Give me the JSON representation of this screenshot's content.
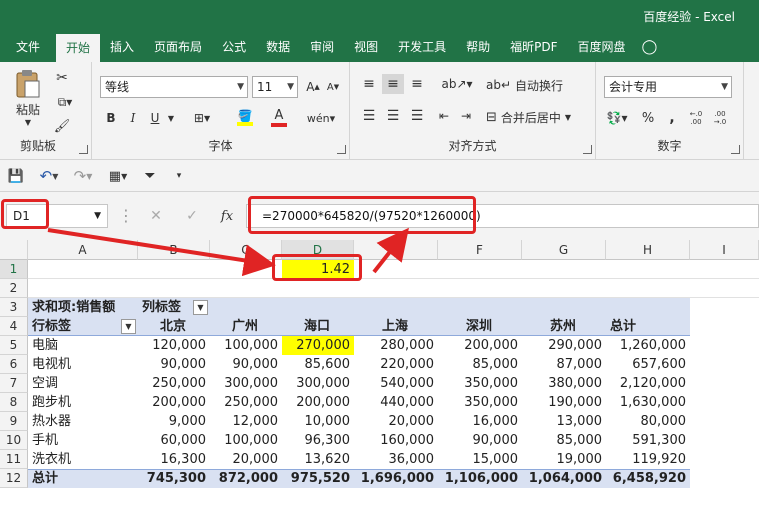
{
  "app": {
    "title": "百度经验 - Excel"
  },
  "tabs": [
    "文件",
    "开始",
    "插入",
    "页面布局",
    "公式",
    "数据",
    "审阅",
    "视图",
    "开发工具",
    "帮助",
    "福昕PDF",
    "百度网盘"
  ],
  "ribbon": {
    "clipboard": {
      "paste": "粘贴",
      "label": "剪贴板"
    },
    "font": {
      "name": "等线",
      "size": "11",
      "label": "字体",
      "bold": "B",
      "italic": "I",
      "underline": "U"
    },
    "align": {
      "wrap": "自动换行",
      "merge": "合并后居中",
      "label": "对齐方式"
    },
    "number": {
      "format": "会计专用",
      "percent": "%",
      "label": "数字"
    }
  },
  "namebox": "D1",
  "formula": "=270000*645820/(97520*1260000)",
  "columns": [
    "A",
    "B",
    "C",
    "D",
    "E",
    "F",
    "G",
    "H",
    "I"
  ],
  "rows": [
    "1",
    "2",
    "3",
    "4",
    "5",
    "6",
    "7",
    "8",
    "9",
    "10",
    "11",
    "12"
  ],
  "d1_value": "1.42",
  "pivot": {
    "header_label": "求和项:销售额",
    "col_label": "列标签",
    "row_label": "行标签",
    "cities": [
      "北京",
      "广州",
      "海口",
      "上海",
      "深圳",
      "苏州",
      "总计"
    ],
    "data": [
      {
        "name": "电脑",
        "values": [
          "120,000",
          "100,000",
          "270,000",
          "280,000",
          "200,000",
          "290,000",
          "1,260,000"
        ]
      },
      {
        "name": "电视机",
        "values": [
          "90,000",
          "90,000",
          "85,600",
          "220,000",
          "85,000",
          "87,000",
          "657,600"
        ]
      },
      {
        "name": "空调",
        "values": [
          "250,000",
          "300,000",
          "300,000",
          "540,000",
          "350,000",
          "380,000",
          "2,120,000"
        ]
      },
      {
        "name": "跑步机",
        "values": [
          "200,000",
          "250,000",
          "200,000",
          "440,000",
          "350,000",
          "190,000",
          "1,630,000"
        ]
      },
      {
        "name": "热水器",
        "values": [
          "9,000",
          "12,000",
          "10,000",
          "20,000",
          "16,000",
          "13,000",
          "80,000"
        ]
      },
      {
        "name": "手机",
        "values": [
          "60,000",
          "100,000",
          "96,300",
          "160,000",
          "90,000",
          "85,000",
          "591,300"
        ]
      },
      {
        "name": "洗衣机",
        "values": [
          "16,300",
          "20,000",
          "13,620",
          "36,000",
          "15,000",
          "19,000",
          "119,920"
        ]
      }
    ],
    "total": {
      "name": "总计",
      "values": [
        "745,300",
        "872,000",
        "975,520",
        "1,696,000",
        "1,106,000",
        "1,064,000",
        "6,458,920"
      ]
    }
  },
  "colors": {
    "excel_green": "#217346",
    "highlight": "#ffff00",
    "pivot_band": "#d9e1f2",
    "annotation": "#e02424"
  }
}
